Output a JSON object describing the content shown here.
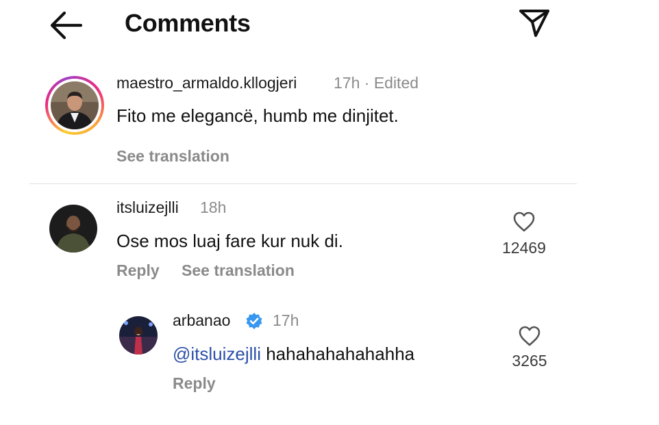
{
  "header": {
    "title": "Comments",
    "back_icon": "arrow-left-icon",
    "share_icon": "paper-plane-icon"
  },
  "comments": [
    {
      "username": "maestro_armaldo.kllogjeri",
      "meta": "17h · Edited",
      "text": "Fito me elegancë, humb me dinjitet.",
      "see_translation": "See translation",
      "avatar_ring": true
    },
    {
      "username": "itsluizejlli",
      "meta": "18h",
      "text": "Ose mos luaj fare kur nuk di.",
      "reply_label": "Reply",
      "see_translation": "See translation",
      "likes": "12469"
    },
    {
      "username": "arbanao",
      "verified": true,
      "meta": "17h",
      "mention": "@itsluizejlli",
      "text": " hahahahahahahha",
      "reply_label": "Reply",
      "likes": "3265"
    }
  ],
  "colors": {
    "muted_text": "#8a8a8a",
    "mention": "#2b4fa8",
    "verified_badge": "#3897f0",
    "divider": "#e2e2e2"
  }
}
